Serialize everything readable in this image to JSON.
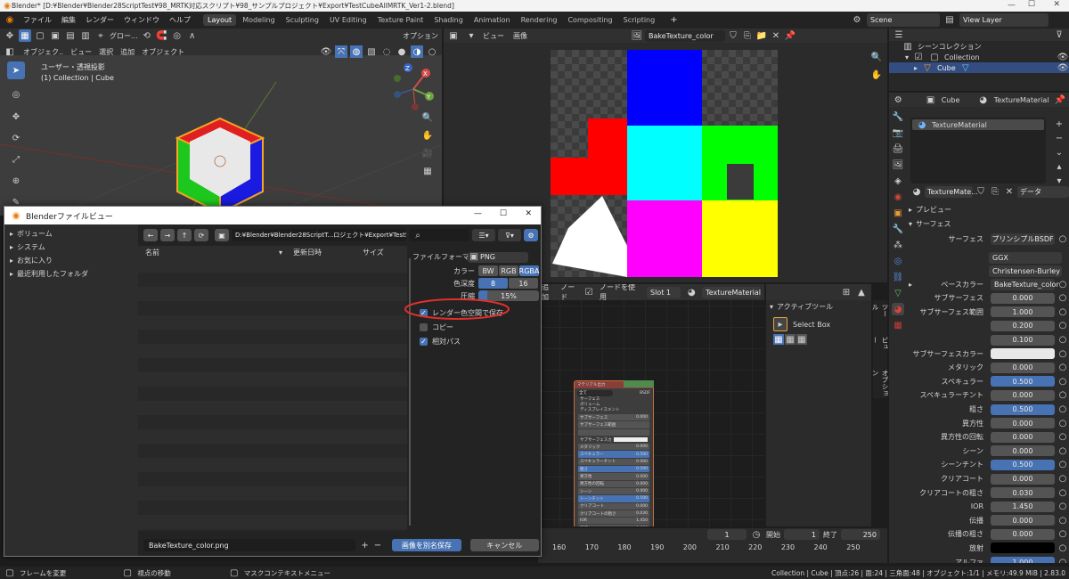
{
  "title_bar": {
    "text": "Blender* [D:¥Blender¥Blender28ScriptTest¥98_MRTK対応スクリプト¥98_サンプルプロジェクト¥Export¥TestCubeAllMRTK_Ver1-2.blend]",
    "min": "—",
    "max": "☐",
    "close": "✕"
  },
  "menu": {
    "items": [
      "ファイル",
      "編集",
      "レンダー",
      "ウィンドウ",
      "ヘルプ"
    ]
  },
  "workspaces": [
    "Layout",
    "Modeling",
    "Sculpting",
    "UV Editing",
    "Texture Paint",
    "Shading",
    "Animation",
    "Rendering",
    "Compositing",
    "Scripting"
  ],
  "workspace_add": "+",
  "scene": {
    "label": "Scene",
    "view_layer": "View Layer"
  },
  "viewport": {
    "mode": "オブジェク..",
    "menus": [
      "ビュー",
      "選択",
      "追加",
      "オブジェクト"
    ],
    "transform": "グロー...",
    "info1": "ユーザー・透視投影",
    "info2": "(1) Collection | Cube",
    "options": "オプション",
    "axis_x": "X",
    "axis_y": "Y",
    "axis_z": "Z"
  },
  "image_editor": {
    "menus": [
      "ビュー",
      "画像"
    ],
    "image_name": "BakeTexture_color"
  },
  "outliner": {
    "title": "シーンコレクション",
    "collection": "Collection",
    "object": "Cube"
  },
  "properties": {
    "breadcrumb_object": "Cube",
    "breadcrumb_material": "TextureMaterial",
    "slot": "TextureMaterial",
    "mat_name": "TextureMate...",
    "data_label": "データ",
    "preview": "プレビュー",
    "surface_section": "サーフェス",
    "surface_label": "サーフェス",
    "surface_value": "プリンシプルBSDF",
    "dist": "GGX",
    "sss_method": "Christensen-Burley",
    "base_color_label": "ベースカラー",
    "base_color_value": "BakeTexture_color",
    "rows": [
      {
        "label": "サブサーフェス",
        "value": "0.000"
      },
      {
        "label": "サブサーフェス範囲",
        "value": "1.000"
      },
      {
        "label": "",
        "value": "0.200"
      },
      {
        "label": "",
        "value": "0.100"
      },
      {
        "label": "サブサーフェスカラー",
        "value": ""
      },
      {
        "label": "メタリック",
        "value": "0.000"
      },
      {
        "label": "スペキュラー",
        "value": "0.500"
      },
      {
        "label": "スペキュラーチント",
        "value": "0.000"
      },
      {
        "label": "粗さ",
        "value": "0.500"
      },
      {
        "label": "異方性",
        "value": "0.000"
      },
      {
        "label": "異方性の回転",
        "value": "0.000"
      },
      {
        "label": "シーン",
        "value": "0.000"
      },
      {
        "label": "シーンチント",
        "value": "0.500"
      },
      {
        "label": "クリアコート",
        "value": "0.000"
      },
      {
        "label": "クリアコートの粗さ",
        "value": "0.030"
      },
      {
        "label": "IOR",
        "value": "1.450"
      },
      {
        "label": "伝播",
        "value": "0.000"
      },
      {
        "label": "伝播の粗さ",
        "value": "0.000"
      },
      {
        "label": "放射",
        "value": ""
      },
      {
        "label": "アルファ",
        "value": "1.000"
      }
    ]
  },
  "node_editor": {
    "menus": [
      "追加",
      "ノード"
    ],
    "use_nodes": "ノードを使用",
    "slot": "Slot 1",
    "material": "TextureMaterial",
    "node_title": "マテリアル出力",
    "node_target": "全て",
    "node_bsdf": "BSDF",
    "node_outputs": [
      "サーフェス",
      "ボリューム",
      "ディスプレイスメント"
    ],
    "bsdf_rows": [
      "サブサーフェス",
      "サブサーフェス範囲",
      "",
      "サブサーフェスカ",
      "メタリック",
      "スペキュラー",
      "スペキュラーチント",
      "粗さ",
      "異方性",
      "異方性の回転",
      "シーン",
      "シーンチント",
      "クリアコート",
      "クリアコートの粗さ",
      "IOR",
      "伝播"
    ],
    "bsdf_vals": [
      "0.000",
      "",
      "",
      "",
      "0.000",
      "0.500",
      "0.000",
      "0.500",
      "0.000",
      "0.000",
      "0.000",
      "0.500",
      "0.000",
      "0.030",
      "1.450",
      "0.000"
    ]
  },
  "tool_panel": {
    "title": "アクティブツール",
    "tool": "Select Box",
    "tabs": [
      "ツール",
      "ビュー",
      "オプション"
    ]
  },
  "timeline": {
    "frame": "1",
    "start_label": "開始",
    "start": "1",
    "end_label": "終了",
    "end": "250",
    "ticks": [
      "160",
      "170",
      "180",
      "190",
      "200",
      "210",
      "220",
      "230",
      "240",
      "250"
    ]
  },
  "status": {
    "left1": "フレームを変更",
    "left2": "視点の移動",
    "mid": "マスクコンテキストメニュー",
    "right": "Collection | Cube | 頂点:26 | 面:24 | 三角面:48 | オブジェクト:1/1 | メモリ:49.9 MiB | 2.83.0"
  },
  "file_dialog": {
    "title": "Blenderファイルビュー",
    "min": "—",
    "max": "☐",
    "close": "✕",
    "sidebar": [
      "ボリューム",
      "システム",
      "お気に入り",
      "最近利用したフォルダ"
    ],
    "path": "D:¥Blender¥Blender28ScriptT...ロジェクト¥Export¥TestSave¥",
    "cols": {
      "name": "名前",
      "date": "更新日時",
      "size": "サイズ"
    },
    "format_label": "ファイルフォーマ...",
    "format_value": "PNG",
    "color_label": "カラー",
    "color_opts": [
      "BW",
      "RGB",
      "RGBA"
    ],
    "depth_label": "色深度",
    "depth_opts": [
      "8",
      "16"
    ],
    "compress_label": "圧縮",
    "compress_value": "15%",
    "compress_frac": 0.15,
    "checks": [
      {
        "label": "レンダー色空間で保存",
        "checked": true
      },
      {
        "label": "コピー",
        "checked": false
      },
      {
        "label": "相対パス",
        "checked": true
      }
    ],
    "filename": "BakeTexture_color.png",
    "plus": "+",
    "minus": "−",
    "save": "画像を別名保存",
    "cancel": "キャンセル"
  },
  "colors": {
    "accent": "#4772b3",
    "highlight": "#e0302a"
  }
}
